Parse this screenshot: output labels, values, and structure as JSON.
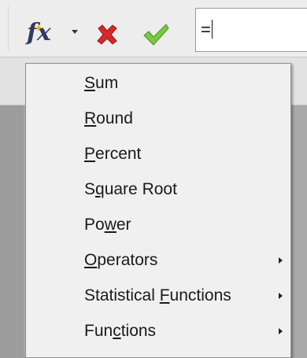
{
  "toolbar": {
    "function_icon": "fx-function-wizard-icon",
    "cancel_icon": "red-x-icon",
    "accept_icon": "green-check-icon",
    "formula_value": "="
  },
  "menu": {
    "items": [
      {
        "label": "Sum",
        "accel_index": 0,
        "has_submenu": false
      },
      {
        "label": "Round",
        "accel_index": 0,
        "has_submenu": false
      },
      {
        "label": "Percent",
        "accel_index": 0,
        "has_submenu": false
      },
      {
        "label": "Square Root",
        "accel_index": 1,
        "has_submenu": false
      },
      {
        "label": "Power",
        "accel_index": 2,
        "has_submenu": false
      },
      {
        "label": "Operators",
        "accel_index": 0,
        "has_submenu": true
      },
      {
        "label": "Statistical Functions",
        "accel_index": 12,
        "has_submenu": true
      },
      {
        "label": "Functions",
        "accel_index": 3,
        "has_submenu": true
      }
    ]
  },
  "colors": {
    "cancel": "#d42a2a",
    "accept": "#6fbf3a",
    "fx": "#2f3b66"
  }
}
